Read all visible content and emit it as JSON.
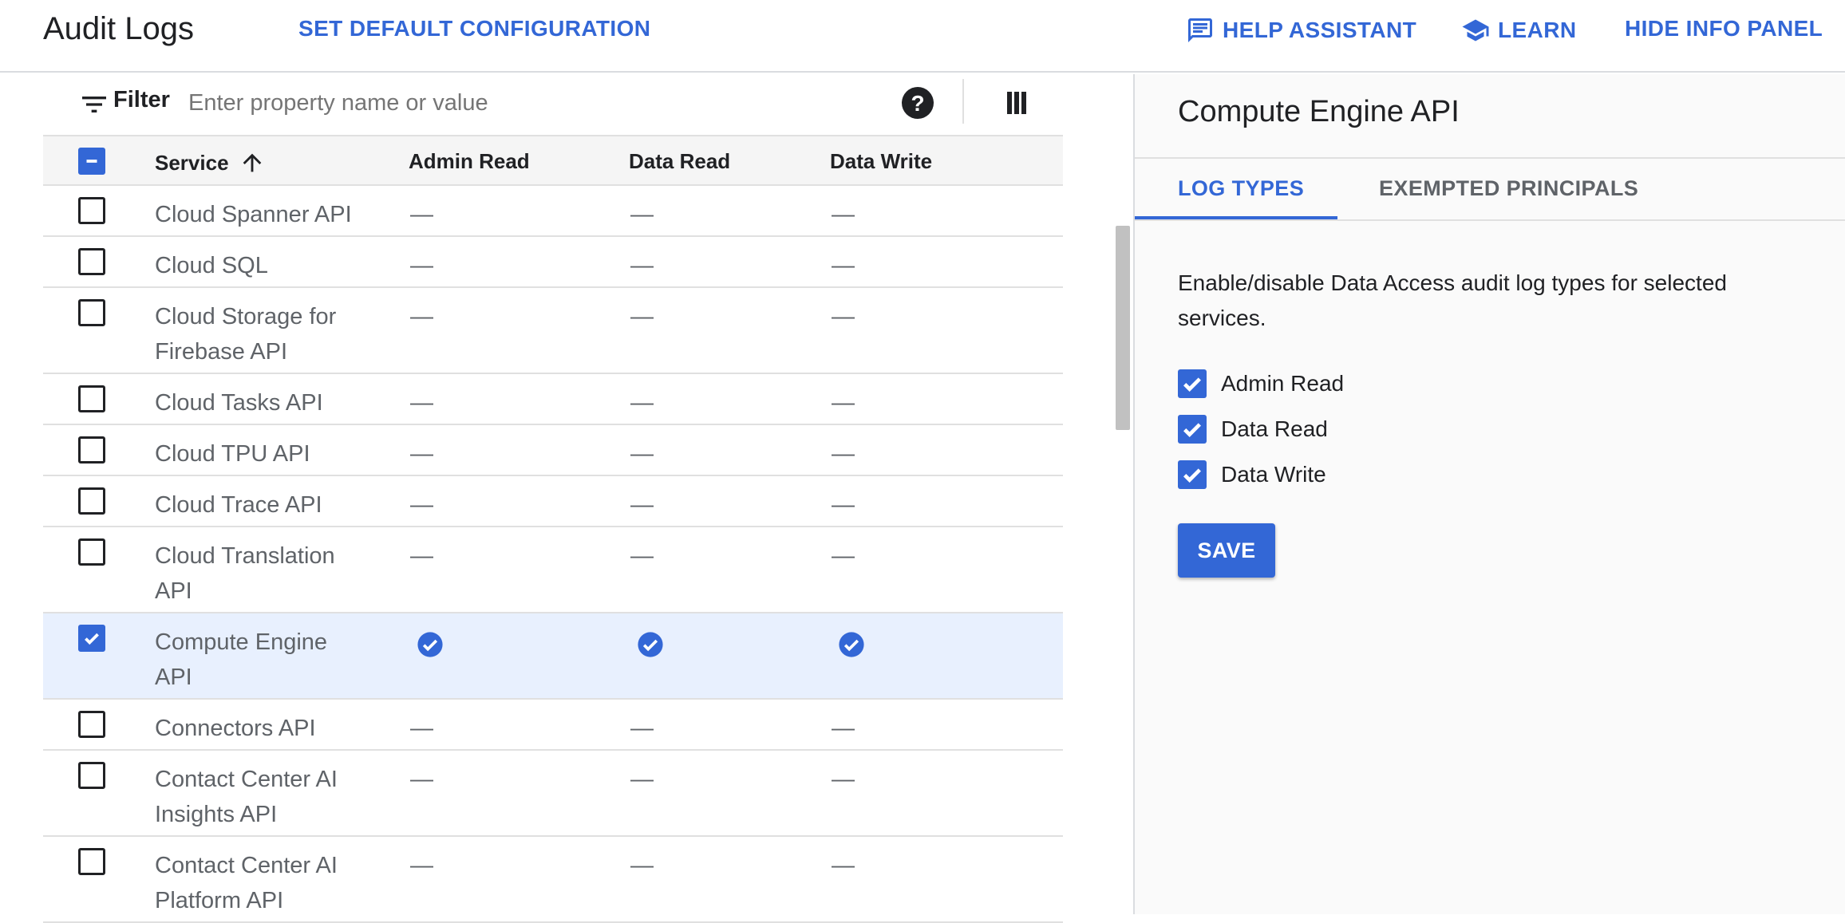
{
  "header": {
    "title": "Audit Logs",
    "set_default": "SET DEFAULT CONFIGURATION",
    "help_assistant": "HELP ASSISTANT",
    "learn": "LEARN",
    "hide_info_panel": "HIDE INFO PANEL"
  },
  "filter": {
    "label": "Filter",
    "placeholder": "Enter property name or value"
  },
  "table": {
    "columns": {
      "service": "Service",
      "admin_read": "Admin Read",
      "data_read": "Data Read",
      "data_write": "Data Write"
    },
    "rows": [
      {
        "service": "Cloud Spanner API",
        "admin_read": "—",
        "data_read": "—",
        "data_write": "—",
        "checked": false
      },
      {
        "service": "Cloud SQL",
        "admin_read": "—",
        "data_read": "—",
        "data_write": "—",
        "checked": false
      },
      {
        "service": "Cloud Storage for Firebase API",
        "admin_read": "—",
        "data_read": "—",
        "data_write": "—",
        "checked": false
      },
      {
        "service": "Cloud Tasks API",
        "admin_read": "—",
        "data_read": "—",
        "data_write": "—",
        "checked": false
      },
      {
        "service": "Cloud TPU API",
        "admin_read": "—",
        "data_read": "—",
        "data_write": "—",
        "checked": false
      },
      {
        "service": "Cloud Trace API",
        "admin_read": "—",
        "data_read": "—",
        "data_write": "—",
        "checked": false
      },
      {
        "service": "Cloud Translation API",
        "admin_read": "—",
        "data_read": "—",
        "data_write": "—",
        "checked": false
      },
      {
        "service": "Compute Engine API",
        "admin_read": "enabled",
        "data_read": "enabled",
        "data_write": "enabled",
        "checked": true
      },
      {
        "service": "Connectors API",
        "admin_read": "—",
        "data_read": "—",
        "data_write": "—",
        "checked": false
      },
      {
        "service": "Contact Center AI Insights API",
        "admin_read": "—",
        "data_read": "—",
        "data_write": "—",
        "checked": false
      },
      {
        "service": "Contact Center AI Platform API",
        "admin_read": "—",
        "data_read": "—",
        "data_write": "—",
        "checked": false
      }
    ]
  },
  "info_panel": {
    "title": "Compute Engine API",
    "tabs": [
      "LOG TYPES",
      "EXEMPTED PRINCIPALS"
    ],
    "active_tab": "LOG TYPES",
    "description": "Enable/disable Data Access audit log types for selected services.",
    "options": [
      {
        "label": "Admin Read",
        "checked": true
      },
      {
        "label": "Data Read",
        "checked": true
      },
      {
        "label": "Data Write",
        "checked": true
      }
    ],
    "save_label": "SAVE"
  },
  "colors": {
    "accent": "#3367d6",
    "selected_row": "#e8f0fe",
    "header_bg": "#f5f5f5"
  },
  "icons": {
    "help_assistant": "chat-icon",
    "learn": "graduation-cap-icon",
    "filter": "filter-icon",
    "help": "help-circle-icon",
    "columns": "columns-icon",
    "sort": "arrow-up-icon",
    "enabled": "check-circle-icon"
  }
}
